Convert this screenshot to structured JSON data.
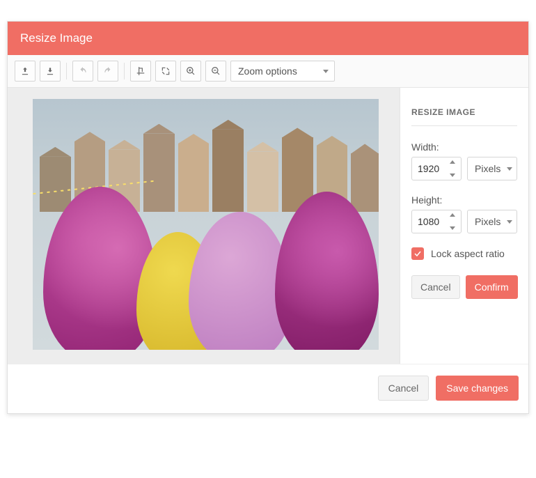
{
  "header": {
    "title": "Resize Image"
  },
  "toolbar": {
    "zoom_label": "Zoom options",
    "icons": {
      "upload": "upload-icon",
      "download": "download-icon",
      "undo": "undo-icon",
      "redo": "redo-icon",
      "crop": "crop-icon",
      "resize": "resize-icon",
      "zoom_in": "zoom-in-icon",
      "zoom_out": "zoom-out-icon"
    }
  },
  "panel": {
    "title": "RESIZE IMAGE",
    "width_label": "Width:",
    "width_value": "1920",
    "width_unit": "Pixels",
    "height_label": "Height:",
    "height_value": "1080",
    "height_unit": "Pixels",
    "lock_label": "Lock aspect ratio",
    "lock_checked": true,
    "cancel_label": "Cancel",
    "confirm_label": "Confirm"
  },
  "footer": {
    "cancel_label": "Cancel",
    "save_label": "Save changes"
  },
  "colors": {
    "accent": "#f06e64"
  }
}
